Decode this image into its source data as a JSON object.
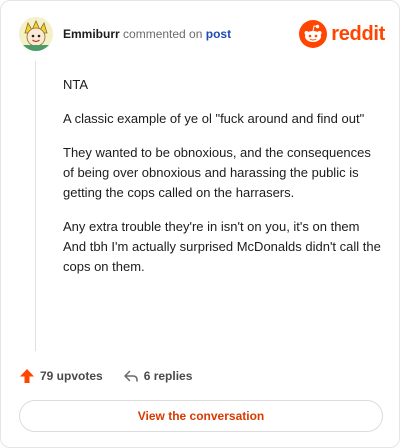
{
  "comment": {
    "username": "Emmiburr",
    "action_text": "commented on",
    "post_link": "post",
    "paragraphs": [
      "NTA",
      "A classic example of ye ol \"fuck around and find out\"",
      "They wanted to be obnoxious, and the consequences of being over obnoxious and harassing the public is getting the cops called on the harrasers.",
      "Any extra trouble they're in isn't on you, it's on them And tbh I'm actually surprised McDonalds didn't call the cops on them."
    ]
  },
  "brand": {
    "wordmark": "reddit",
    "color": "#ff4500"
  },
  "stats": {
    "upvotes": "79 upvotes",
    "replies": "6 replies"
  },
  "cta": {
    "label": "View the conversation"
  },
  "icons": {
    "avatar": "user-avatar",
    "logo": "reddit-logo-icon",
    "upvote": "upvote-arrow-icon",
    "reply": "reply-arrow-icon"
  }
}
